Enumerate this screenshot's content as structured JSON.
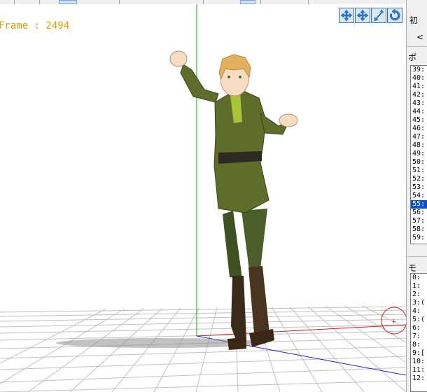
{
  "viewport": {
    "frame_label": "Frame : 2494",
    "tools": [
      {
        "icon": "move-xy-icon"
      },
      {
        "icon": "move-xz-icon"
      },
      {
        "icon": "move-z-icon"
      },
      {
        "icon": "rotate-icon"
      }
    ]
  },
  "side_panel": {
    "top_label": "初",
    "nav_label": "<",
    "bone_section_label": "ボ",
    "bone_rows": [
      "39:",
      "40:",
      "41:",
      "42:",
      "43:",
      "44:",
      "45:",
      "46:",
      "47:",
      "48:",
      "49:",
      "50:",
      "51:",
      "52:",
      "53:",
      "54:",
      "55:",
      "56:",
      "57:",
      "58:",
      "59:"
    ],
    "bone_selected_index": 16,
    "model_section_label": "モ",
    "model_rows": [
      "0:",
      "1:",
      "2:",
      "3:(",
      "4:",
      "5:(",
      "6:",
      "7:",
      "8:",
      "9:[",
      "10:",
      "11:",
      "12:"
    ]
  },
  "colors": {
    "frame_label": "#e0a000",
    "selection": "#0a52c2",
    "y_axis": "#18a018",
    "x_axis": "#d02020",
    "z_axis": "#2020d0"
  }
}
